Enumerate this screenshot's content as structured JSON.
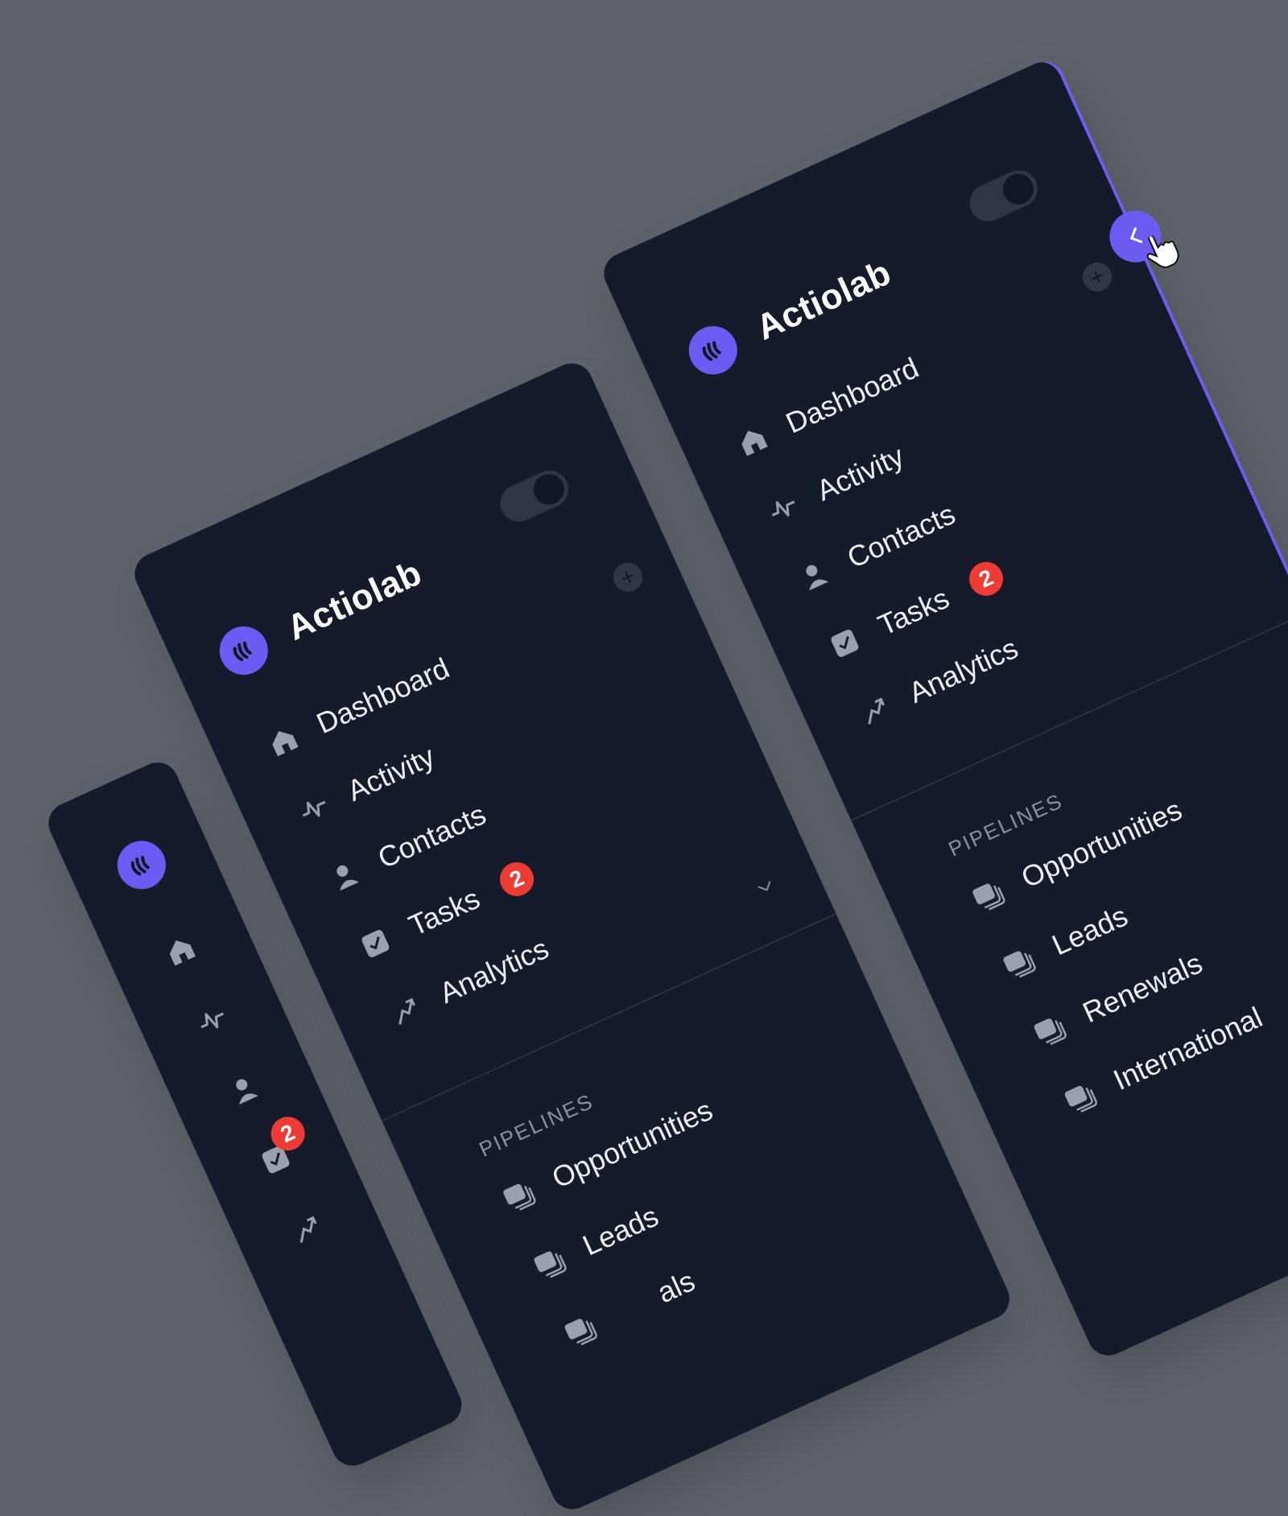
{
  "brand": {
    "name": "Actiolab"
  },
  "nav": {
    "dashboard": "Dashboard",
    "activity": "Activity",
    "contacts": "Contacts",
    "tasks": "Tasks",
    "tasks_badge": "2",
    "analytics": "Analytics"
  },
  "pipelines": {
    "heading": "PIPELINES",
    "items": [
      "Opportunities",
      "Leads",
      "Renewals",
      "International"
    ],
    "partial_item": "als"
  },
  "colors": {
    "accent": "#6d5cf3",
    "badge": "#ee3b33",
    "panel": "#161b2c",
    "background": "#5f646c"
  },
  "icons": {
    "dashboard": "home-icon",
    "activity": "activity-pulse-icon",
    "contacts": "user-icon",
    "tasks": "checkbox-icon",
    "analytics": "trend-arrow-icon",
    "pipeline": "stack-icon"
  }
}
